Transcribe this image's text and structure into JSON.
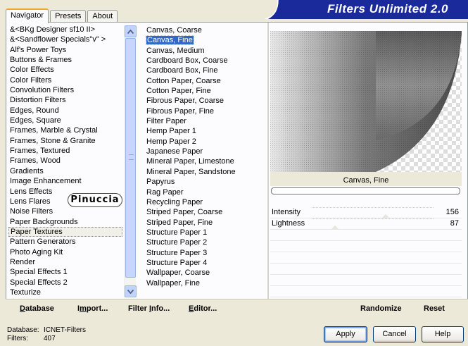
{
  "tabs": [
    "Navigator",
    "Presets",
    "About"
  ],
  "title": "Filters Unlimited 2.0",
  "categories": [
    "&<BKg Designer sf10 II>",
    "&<Sandflower Specials\"v\" >",
    "Alf's Power Toys",
    "Buttons & Frames",
    "Color Effects",
    "Color Filters",
    "Convolution Filters",
    "Distortion Filters",
    "Edges, Round",
    "Edges, Square",
    "Frames, Marble & Crystal",
    "Frames, Stone & Granite",
    "Frames, Textured",
    "Frames, Wood",
    "Gradients",
    "Image Enhancement",
    "Lens Effects",
    "Lens Flares",
    "Noise Filters",
    "Paper Backgrounds",
    "Paper Textures",
    "Pattern Generators",
    "Photo Aging Kit",
    "Render",
    "Special Effects 1",
    "Special Effects 2",
    "Texturize"
  ],
  "selected_category": "Paper Textures",
  "filters": [
    "Canvas, Coarse",
    "Canvas, Fine",
    "Canvas, Medium",
    "Cardboard Box, Coarse",
    "Cardboard Box, Fine",
    "Cotton Paper, Coarse",
    "Cotton Paper, Fine",
    "Fibrous Paper, Coarse",
    "Fibrous Paper, Fine",
    "Filter Paper",
    "Hemp Paper 1",
    "Hemp Paper 2",
    "Japanese Paper",
    "Mineral Paper, Limestone",
    "Mineral Paper, Sandstone",
    "Papyrus",
    "Rag Paper",
    "Recycling Paper",
    "Striped Paper, Coarse",
    "Striped Paper, Fine",
    "Structure Paper 1",
    "Structure Paper 2",
    "Structure Paper 3",
    "Structure Paper 4",
    "Wallpaper, Coarse",
    "Wallpaper, Fine"
  ],
  "selected_filter": "Canvas, Fine",
  "preview_label": "Canvas, Fine",
  "params": [
    {
      "label": "Intensity",
      "value": 156
    },
    {
      "label": "Lightness",
      "value": 87
    }
  ],
  "bottom": {
    "database": {
      "u": "D",
      "rest": "atabase"
    },
    "import": {
      "pre": "I",
      "u": "m",
      "rest": "port..."
    },
    "filter_info": {
      "pre": "Filter ",
      "u": "I",
      "rest": "nfo..."
    },
    "editor": {
      "u": "E",
      "rest": "ditor..."
    },
    "randomize": "Randomize",
    "reset": "Reset"
  },
  "status": {
    "database_label": "Database:",
    "database_value": "ICNET-Filters",
    "filters_label": "Filters:",
    "filters_value": "407"
  },
  "buttons": {
    "apply": "Apply",
    "cancel": "Cancel",
    "help": "Help"
  },
  "watermark": "Pinuccia",
  "colors": {
    "selection": "#316ac5",
    "banner": "#1a2a9a",
    "tab_accent": "#f5a623"
  }
}
